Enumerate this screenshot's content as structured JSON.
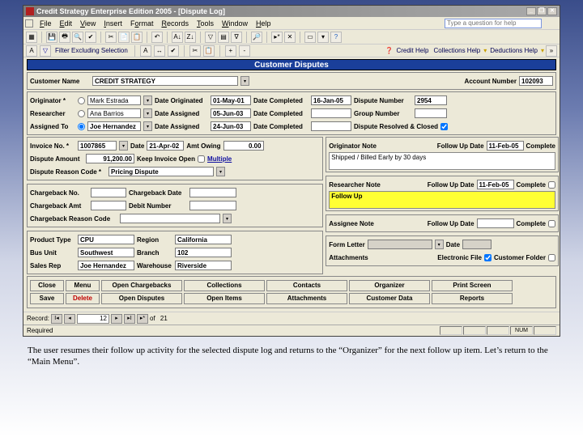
{
  "titlebar": {
    "title": "Credit Strategy Enterprise Edition 2005 - [Dispute Log]"
  },
  "ask": {
    "placeholder": "Type a question for help"
  },
  "menu": {
    "file": "File",
    "edit": "Edit",
    "view": "View",
    "insert": "Insert",
    "format": "Format",
    "records": "Records",
    "tools": "Tools",
    "window": "Window",
    "help": "Help"
  },
  "toolbar2": {
    "filter": "Filter Excluding Selection",
    "credit_help": "Credit Help",
    "collections_help": "Collections Help",
    "deductions_help": "Deductions Help"
  },
  "header": {
    "title": "Customer Disputes"
  },
  "custrow": {
    "name_label": "Customer Name",
    "name_value": "CREDIT STRATEGY",
    "acct_label": "Account Number",
    "acct_value": "102093"
  },
  "people": {
    "orig_label": "Originator *",
    "orig_value": "Mark Estrada",
    "date_orig_label": "Date Originated",
    "date_orig_value": "01-May-01",
    "date_comp1_label": "Date Completed",
    "date_comp1_value": "16-Jan-05",
    "disp_no_label": "Dispute Number",
    "disp_no_value": "2954",
    "res_label": "Researcher",
    "res_value": "Ana Barrios",
    "date_asn1_label": "Date Assigned",
    "date_asn1_value": "05-Jun-03",
    "date_comp2_label": "Date Completed",
    "date_comp2_value": "",
    "group_label": "Group Number",
    "group_value": "",
    "asn_label": "Assigned To",
    "asn_value": "Joe Hernandez",
    "date_asn2_label": "Date Assigned",
    "date_asn2_value": "24-Jun-03",
    "date_comp3_label": "Date Completed",
    "date_comp3_value": "",
    "status_label": "Dispute Resolved & Closed"
  },
  "invoice": {
    "invno_label": "Invoice No. *",
    "invno_value": "1007865",
    "date_label": "Date",
    "date_value": "21-Apr-02",
    "amt_owing_label": "Amt Owing",
    "amt_owing_value": "0.00",
    "disp_amt_label": "Dispute Amount",
    "disp_amt_value": "91,200.00",
    "keep_open_label": "Keep Invoice Open",
    "multi": "Multiple",
    "reason_label": "Dispute Reason Code *",
    "reason_value": "Pricing Dispute"
  },
  "notes": {
    "orig_note_label": "Originator Note",
    "orig_fud_label": "Follow Up Date",
    "orig_fud_value": "11-Feb-05",
    "orig_complete_label": "Complete",
    "orig_note_text": "Shipped / Billed Early by 30 days",
    "res_note_label": "Researcher Note",
    "res_fud_label": "Follow Up Date",
    "res_fud_value": "11-Feb-05",
    "res_complete_label": "Complete",
    "res_note_text": "Follow Up",
    "asn_note_label": "Assignee Note",
    "asn_fud_label": "Follow Up Date",
    "asn_fud_value": "",
    "asn_complete_label": "Complete",
    "form_letter_label": "Form Letter",
    "form_letter_value": "",
    "fl_date_label": "Date",
    "fl_date_value": "",
    "attach_label": "Attachments",
    "efile_label": "Electronic File",
    "cfolder_label": "Customer Folder"
  },
  "chargeback": {
    "cbno_label": "Chargeback No.",
    "cbno_value": "",
    "cbdate_label": "Chargeback Date",
    "cbdate_value": "",
    "cbamt_label": "Chargeback Amt",
    "cbamt_value": "",
    "debit_label": "Debit Number",
    "debit_value": "",
    "cbreason_label": "Chargeback Reason Code",
    "cbreason_value": ""
  },
  "product": {
    "ptype_label": "Product Type",
    "ptype_value": "CPU",
    "region_label": "Region",
    "region_value": "California",
    "bunit_label": "Bus Unit",
    "bunit_value": "Southwest",
    "branch_label": "Branch",
    "branch_value": "102",
    "srep_label": "Sales Rep",
    "srep_value": "Joe Hernandez",
    "wh_label": "Warehouse",
    "wh_value": "Riverside"
  },
  "buttons": {
    "close": "Close",
    "menu": "Menu",
    "save": "Save",
    "delete": "Delete",
    "open_cb": "Open Chargebacks",
    "open_disp": "Open Disputes",
    "collections": "Collections",
    "open_items": "Open Items",
    "contacts": "Contacts",
    "attachments": "Attachments",
    "organizer": "Organizer",
    "cust_data": "Customer Data",
    "print": "Print Screen",
    "reports": "Reports"
  },
  "recnav": {
    "label": "Record:",
    "current": "12",
    "of": "of",
    "total": "21"
  },
  "status": {
    "left": "Required",
    "num": "NUM"
  },
  "caption": "The user resumes their follow up activity for the selected dispute log and returns to the “Organizer” for the next follow up item. Let’s return to the “Main Menu”."
}
